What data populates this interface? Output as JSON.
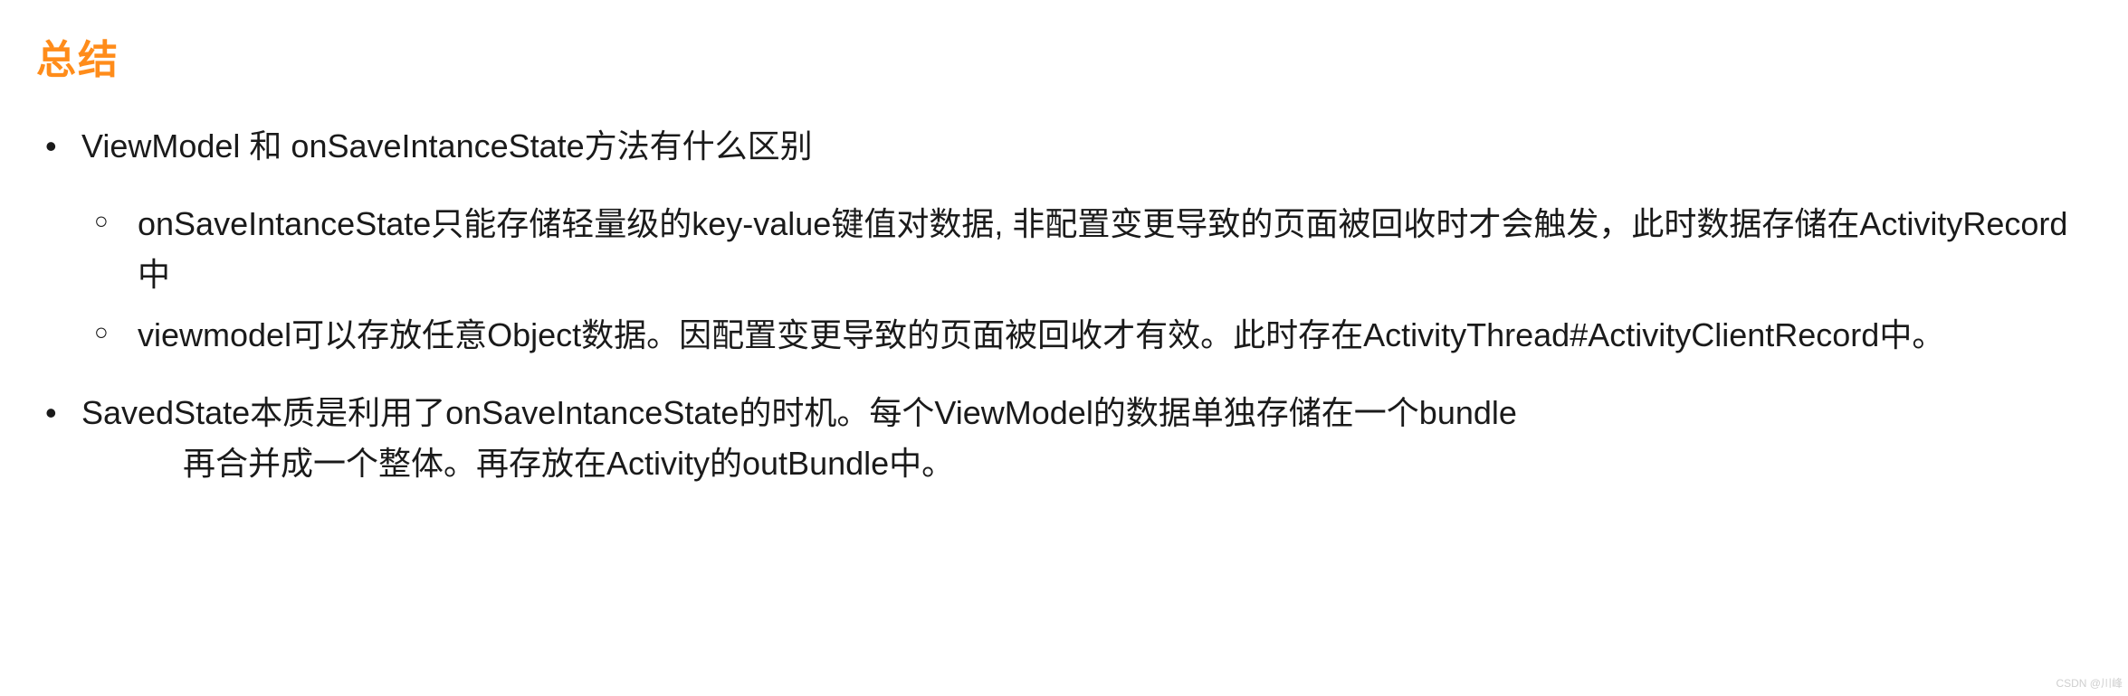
{
  "heading": "总结",
  "bullets": [
    {
      "text": "ViewModel 和 onSaveIntanceState方法有什么区别",
      "children": [
        "onSaveIntanceState只能存储轻量级的key-value键值对数据, 非配置变更导致的页面被回收时才会触发，此时数据存储在ActivityRecord中",
        "viewmodel可以存放任意Object数据。因配置变更导致的页面被回收才有效。此时存在ActivityThread#ActivityClientRecord中。"
      ]
    },
    {
      "text": "SavedState本质是利用了onSaveIntanceState的时机。每个ViewModel的数据单独存储在一个bundle",
      "continuation": "再合并成一个整体。再存放在Activity的outBundle中。"
    }
  ],
  "watermark": "CSDN @川峰"
}
